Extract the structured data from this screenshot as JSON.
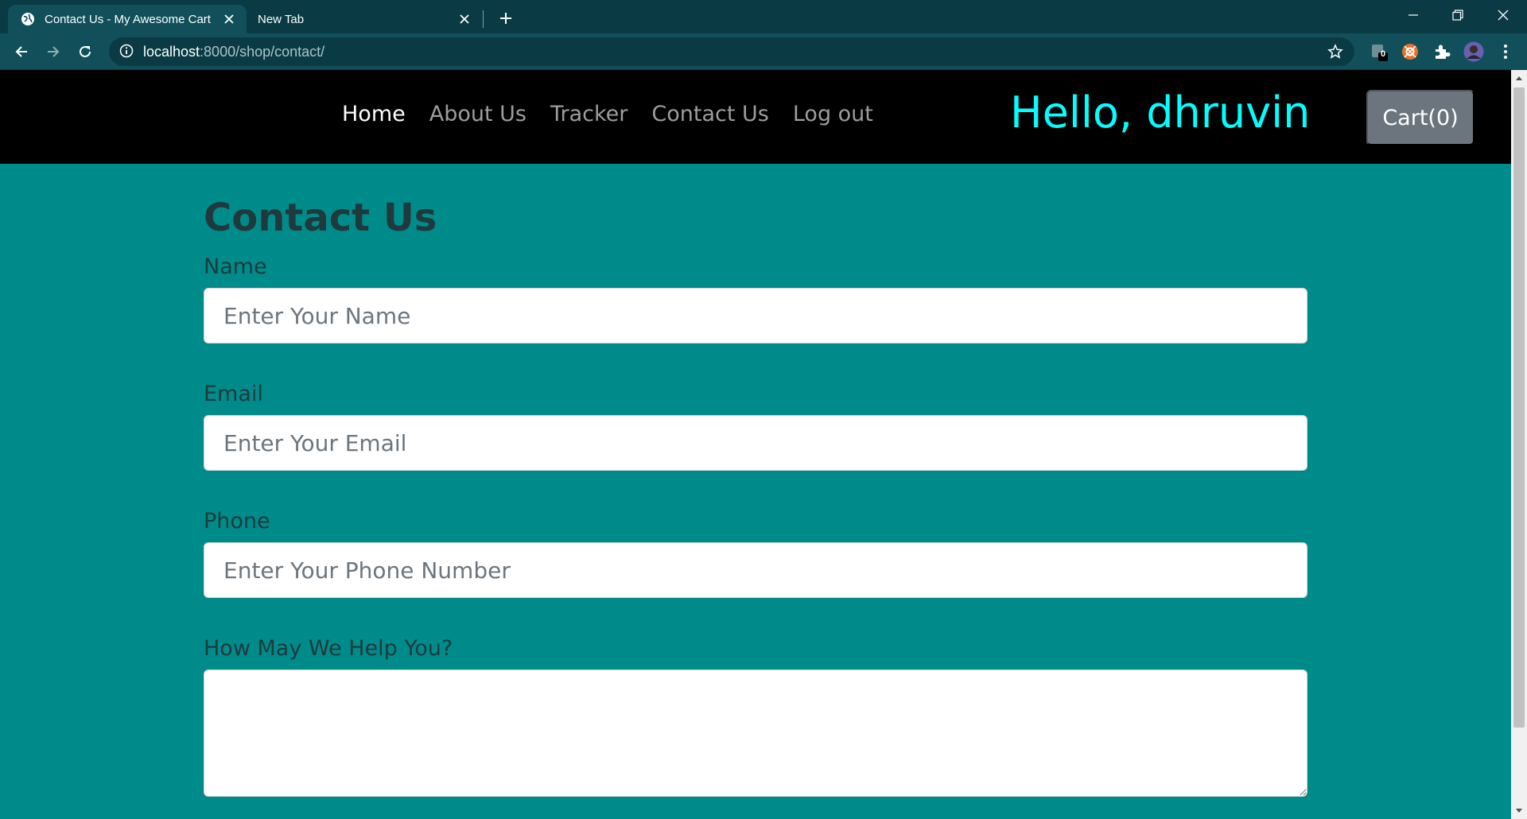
{
  "browser": {
    "tabs": [
      {
        "title": "Contact Us - My Awesome Cart",
        "active": true,
        "favicon": "globe-icon"
      },
      {
        "title": "New Tab",
        "active": false
      }
    ],
    "url_host": "localhost",
    "url_path": ":8000/shop/contact/",
    "extensions": {
      "badge_count": "0"
    }
  },
  "navbar": {
    "links": [
      {
        "label": "Home",
        "active": true
      },
      {
        "label": "About Us",
        "active": false
      },
      {
        "label": "Tracker",
        "active": false
      },
      {
        "label": "Contact Us",
        "active": false
      },
      {
        "label": "Log out",
        "active": false
      }
    ],
    "greeting": "Hello, dhruvin",
    "cart_label": "Cart(0)"
  },
  "form": {
    "title": "Contact Us",
    "name_label": "Name",
    "name_placeholder": "Enter Your Name",
    "email_label": "Email",
    "email_placeholder": "Enter Your Email",
    "phone_label": "Phone",
    "phone_placeholder": "Enter Your Phone Number",
    "help_label": "How May We Help You?"
  },
  "colors": {
    "page_background": "#008b8b",
    "navbar_background": "#000000",
    "greeting": "#00ffff",
    "cart_button": "#6c757d",
    "browser_frame": "#0a3b44"
  }
}
